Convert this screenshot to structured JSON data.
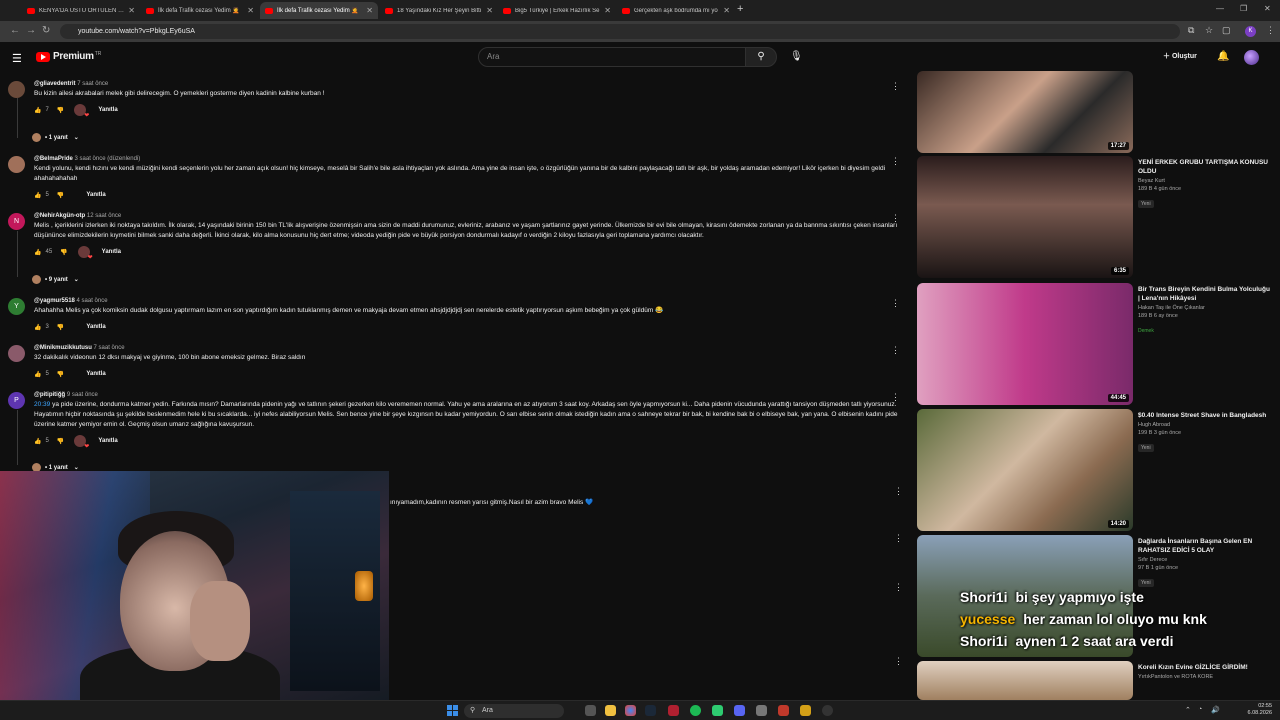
{
  "browser": {
    "tabs": [
      {
        "title": "KENYA'DA ÜSTÜ ÖRTÜLEN KOR",
        "active": false
      },
      {
        "title": "İlk defa Trafik cezası Yedim 🤦",
        "active": false
      },
      {
        "title": "İlk defa Trafik cezası Yedim 🤦",
        "active": true
      },
      {
        "title": "18 Yaşındaki Kız Her Şeyin Bitti",
        "active": false
      },
      {
        "title": "Big5 Türkiye | Erkek Hazırlık Se",
        "active": false
      },
      {
        "title": "Gerçekten aşk bodrumda mı yo",
        "active": false
      }
    ],
    "new_tab": "+",
    "url": "youtube.com/watch?v=PbkgLEy6uSA",
    "profile_initial": "K"
  },
  "youtube": {
    "logo_text": "Premium",
    "logo_region": "TR",
    "search_placeholder": "Ara",
    "create_label": "Oluştur"
  },
  "comments": [
    {
      "author": "@gliavedentrit",
      "time": "7 saat önce",
      "text": "Bu kizin ailesi akrabalari melek gibi delirecegim. O yemekleri gosterme diyen kadinin kalbine kurban !",
      "likes": "7",
      "reply_label": "Yanıtla",
      "avatar_letter": "",
      "avatar_color": "#6a4a3a",
      "replies": "• 1 yanıt"
    },
    {
      "author": "@BelmaPride",
      "time": "3 saat önce (düzenlendi)",
      "text": "Kendi yolunu, kendi hızını ve kendi müziğini kendi seçenlerin yolu her zaman açık olsun! hiç kimseye, meselâ bir Salih'e bile asla ihtiyaçları yok aslında. Ama yine de insan işte, o özgürlüğün yanına bir de kalbini paylaşacağı tatlı bir aşk, bir yoldaş aramadan edemiyor! Likör içerken bi diyesim geldi ahahahahahah",
      "likes": "5",
      "reply_label": "Yanıtla",
      "avatar_letter": "",
      "avatar_color": "#a0705a",
      "replies": ""
    },
    {
      "author": "@NehirAkgün-otp",
      "time": "12 saat önce",
      "text": "Melis , içeriklerini izlerken iki noktaya takıldım. İlk olarak, 14 yaşındaki birinin 150 bin TL'lik alışverişine özenmişsin ama sizin de maddi durumunuz, evleriniz, arabanız ve yaşam şartlarınız gayet yerinde. Ülkemizde bir evi bile olmayan, kirasını ödemekte zorlanan ya da bannma sıkıntısı çeken insanları düşününce elimizdekilerin kıymetini bilmek sanki daha değerli. İkinci olarak, kilo alma konusunu hiç dert etme; videoda yediğin pide ve büyük porsiyon dondurmalı kadayıf o verdiğin 2 kiloyu fazlasıyla geri toplamana yardımcı olacaktır.",
      "likes": "45",
      "reply_label": "Yanıtla",
      "avatar_letter": "N",
      "avatar_color": "#c2185b",
      "replies": "• 9 yanıt"
    },
    {
      "author": "@yagmur5518",
      "time": "4 saat önce",
      "text": "Ahahahha Melis ya çok komiksin dudak dolgusu yaptırmam lazım en son yaptırdığım kadın tutuklanmış demen ve makyaja devam etmen ahsjdjdjdjdj sen nerelerde estetik yaptırıyorsun aşkım bebeğim ya çok güldüm 😂",
      "likes": "3",
      "reply_label": "Yanıtla",
      "avatar_letter": "Y",
      "avatar_color": "#2e7d32",
      "replies": ""
    },
    {
      "author": "@Minikmuzikkutusu",
      "time": "7 saat önce",
      "text": "32 dakikalık videonun 12 dksı makyaj ve giyinme, 100 bin abone emeksiz gelmez. Biraz saldın",
      "likes": "5",
      "reply_label": "Yanıtla",
      "avatar_letter": "",
      "avatar_color": "#8a5a6a",
      "replies": ""
    },
    {
      "author": "@pitipitiğğ",
      "time": "9 saat önce",
      "timestamp_link": "20:39",
      "text": "ya pide üzerine, dondurma katmer yedin. Farkında mısın? Damarlarında pidenin yağı ve tatlının şekeri gezerken kilo verememen normal. Yahu ye ama aralarına en az atıyorum 3 saat koy. Arkadaş sen öyle yapmıyorsun ki... Daha pidenin vücudunda yarattığı tansiyon düşmeden tatlı yiyorsunuz. Hayatımın hiçbir noktasında şu şekilde beslenmedim hele ki bu sıcaklarda... iyi nefes alabiliyorsun Melis. Sen bence yine bir şeye kızgınsın bu kadar yemiyordun. O sarı elbise senin olmak istediğin kadın ama o sahneye tekrar bir bak, bi kendine bak bi o elbiseye bak, yan yana. O elbisenin kadını pide üzerine katmer yemiyor emin ol. Geçmiş olsun umarız sağlığına kavuşursun.",
      "likes": "5",
      "reply_label": "Yanıtla",
      "avatar_letter": "P",
      "avatar_color": "#5e35b1",
      "replies": "• 1 yanıt"
    }
  ],
  "partial_comment_text": "ınıyamadım,kadının resmen yarısı gitmiş.Nasıl bir azim bravo Melis",
  "sidebar_videos": [
    {
      "title": "",
      "channel": "",
      "stats": "",
      "badge": "",
      "duration": "17:27",
      "thumb": "linear-gradient(135deg,#3a2a24,#c9a089 45%,#2a2a2a 70%,#8a6a5a)"
    },
    {
      "title": "YENİ ERKEK GRUBU TARTIŞMA KONUSU OLDU",
      "channel": "Beyaz Kurt",
      "stats": "189 B   4 gün önce",
      "badge": "Yeni",
      "duration": "6:35",
      "thumb": "linear-gradient(180deg,#2a1c1c,#7a5a50 40%,#1a1414)"
    },
    {
      "title": "Bir Trans Bireyin Kendini Bulma Yolculuğu | Lena'nın Hikâyesi",
      "channel": "Hakan Taş ile Öne Çıkanlar",
      "stats": "189 B   6 ay önce",
      "badge": "Demek",
      "duration": "44:45",
      "thumb": "linear-gradient(90deg,#e0a0c0,#c03a8a 50%,#7a2a6a)"
    },
    {
      "title": "$0.40 Intense Street Shave in Bangladesh",
      "channel": "Hugh Abroad",
      "stats": "199 B   3 gün önce",
      "badge": "Yeni",
      "duration": "14:20",
      "thumb": "linear-gradient(135deg,#5a6a3a,#d0b8a0 45%,#8a6a50 70%,#2a3a2a)"
    },
    {
      "title": "Dağlarda İnsanların Başına Gelen EN RAHATSIZ EDİCİ 5 OLAY",
      "channel": "Sıfır Derece",
      "stats": "97 B   1 gün önce",
      "badge": "Yeni",
      "duration": "",
      "thumb": "linear-gradient(180deg,#8aa0b8,#5a6a5a 50%,#3a4a2a)"
    },
    {
      "title": "Koreli Kızın Evine GİZLİCE GİRDİM!",
      "channel": "YırtıkPantolon ve ROTA KORE",
      "stats": "",
      "badge": "",
      "duration": "",
      "thumb": "linear-gradient(180deg,#e0d0c0,#a08060)"
    }
  ],
  "chat": [
    {
      "user": "Shori1i",
      "message": "bi şey yapmıyo işte",
      "gold": false
    },
    {
      "user": "yucesse",
      "message": "her zaman lol oluyo mu knk",
      "gold": true
    },
    {
      "user": "Shori1i",
      "message": "aynen 1 2 saat ara verdi",
      "gold": false
    }
  ],
  "taskbar": {
    "search_label": "Ara",
    "time": "02:55",
    "date": "6.08.2026"
  }
}
